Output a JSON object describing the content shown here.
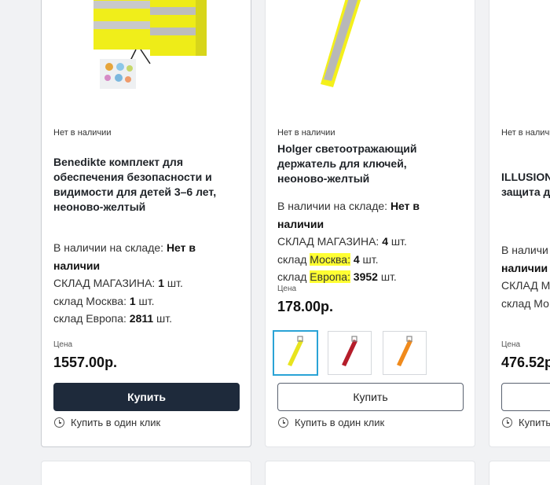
{
  "colors": {
    "accent_dark": "#1e2a3b",
    "highlight": "#ffff33",
    "selected_thumb": "#2aa3d6"
  },
  "cards": [
    {
      "stock_flag": "Нет в наличии",
      "title": [
        "Benedikte комплект для",
        "обеспечения безопасности и",
        "видимости для детей 3–6 лет,",
        "неоново-желтый"
      ],
      "warehouse": {
        "line1_label": "В наличии на складе: ",
        "line1_value": "Нет в",
        "line2_value": "наличии",
        "store_label": "СКЛАД МАГАЗИНА: ",
        "store_value": "1",
        "store_unit": " шт.",
        "moscow_prefix": "склад ",
        "moscow_name": "Москва",
        "moscow_sep": ": ",
        "moscow_value": "1",
        "moscow_unit": " шт.",
        "europe_prefix": "склад ",
        "europe_name": "Европа",
        "europe_sep": ": ",
        "europe_value": "2811",
        "europe_unit": " шт."
      },
      "price_label": "Цена",
      "price": "1557.00р.",
      "buy_label": "Купить",
      "oneclick_label": "Купить в один клик"
    },
    {
      "stock_flag": "Нет в наличии",
      "title": [
        "Holger светоотражающий",
        "держатель для ключей,",
        "неоново-желтый"
      ],
      "warehouse": {
        "line1_label": "В наличии на складе: ",
        "line1_value": "Нет в",
        "line2_value": "наличии",
        "store_label": "СКЛАД МАГАЗИНА: ",
        "store_value": "4",
        "store_unit": " шт.",
        "moscow_prefix": "склад ",
        "moscow_name": "Москва",
        "moscow_sep": ": ",
        "moscow_value": "4",
        "moscow_unit": " шт.",
        "europe_prefix": "склад ",
        "europe_name": "Европа",
        "europe_sep": ": ",
        "europe_value": "3952",
        "europe_unit": " шт."
      },
      "price_label": "Цена",
      "price": "178.00р.",
      "buy_label": "Купить",
      "oneclick_label": "Купить в один клик"
    },
    {
      "stock_flag": "Нет в наличии",
      "title": [
        "ILLUSION",
        "защита д"
      ],
      "warehouse": {
        "line1_label": "В наличи",
        "line2_value": "наличии",
        "store_label": "СКЛАД М",
        "moscow_prefix": "склад Мо"
      },
      "price_label": "Цена",
      "price": "476.52р",
      "oneclick_label": "Купить"
    }
  ]
}
